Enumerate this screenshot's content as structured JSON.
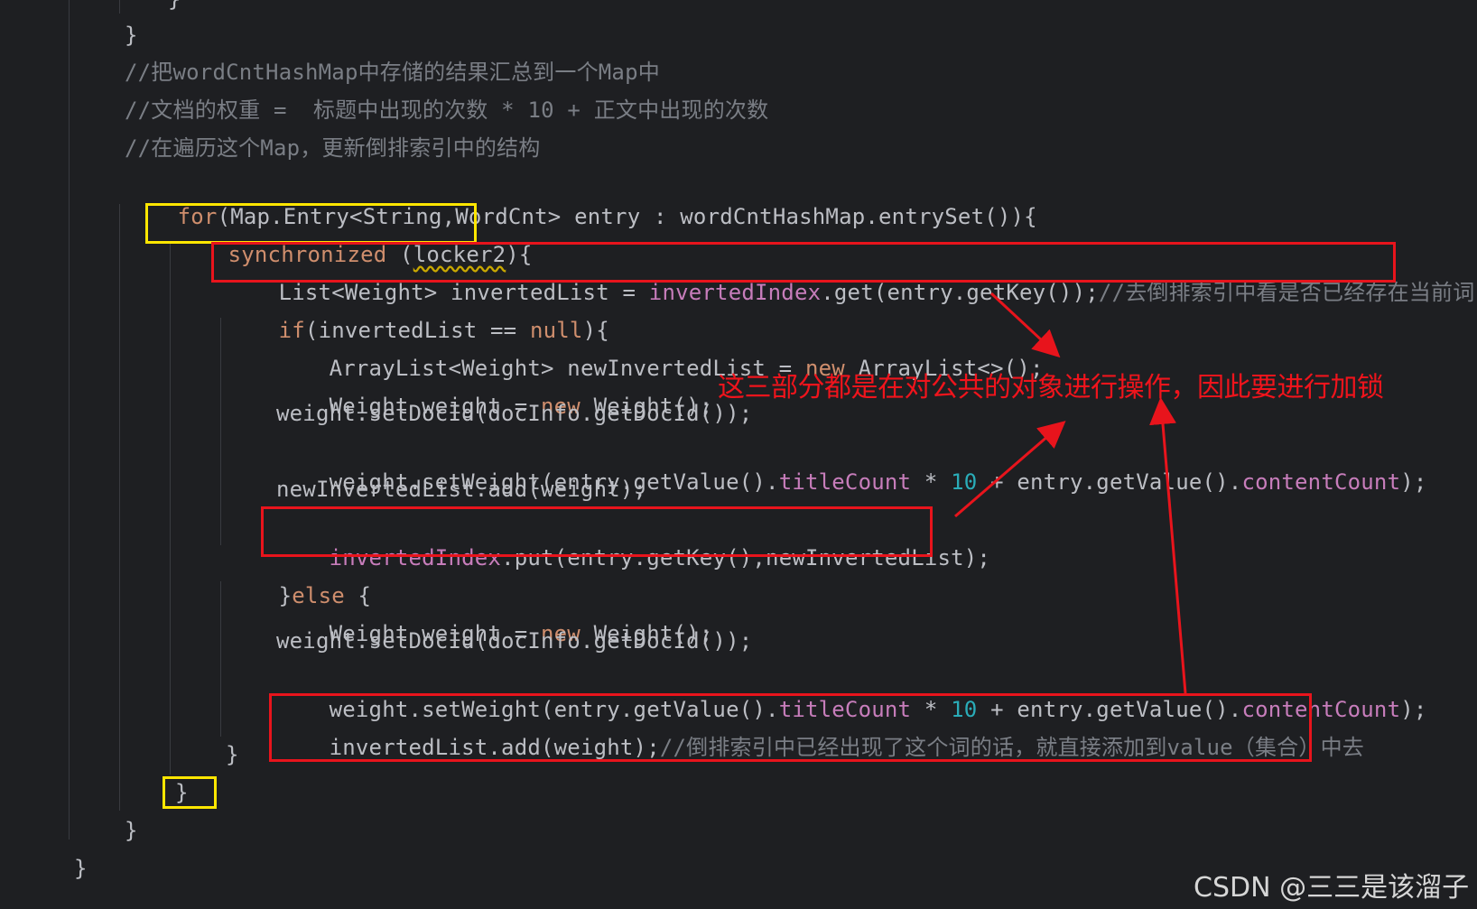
{
  "code": {
    "l0": "}",
    "l1": "}",
    "c1": "//把wordCntHashMap中存储的结果汇总到一个Map中",
    "c2": "//文档的权重 =  标题中出现的次数 * 10 + 正文中出现的次数",
    "c3": "//在遍历这个Map，更新倒排索引中的结构",
    "for_kw": "for",
    "for_rest": "(Map.Entry<String,WordCnt> entry : wordCntHashMap.entrySet()){",
    "sync_kw": "synchronized",
    "sync_open": " (",
    "sync_lock": "locker2",
    "sync_close": "){",
    "list_a": "List<Weight> invertedList = ",
    "list_field": "invertedIndex",
    "list_b": ".get(entry.getKey());",
    "list_comment": "//去倒排索引中看是否已经存在当前词",
    "if_kw": "if",
    "if_a": "(invertedList == ",
    "if_null": "null",
    "if_b": "){",
    "new_list_a": "ArrayList<Weight> newInvertedList = ",
    "new_kw": "new",
    "new_list_b": " ArrayList<>();",
    "weight_decl_a": "Weight weight = ",
    "weight_decl_b": " Weight();",
    "set_doc": "weight.setDocId(docInfo.getDocId());",
    "set_weight_a": "weight.setWeight(entry.getValue().",
    "title_count": "titleCount",
    "set_weight_mul": " * ",
    "ten": "10",
    "set_weight_b": " + entry.getValue().",
    "content_count": "contentCount",
    "set_weight_c": ");",
    "add_new": "newInvertedList.add(weight);",
    "put_field": "invertedIndex",
    "put_rest": ".put(entry.getKey(),newInvertedList);",
    "else_a": "}",
    "else_kw": "else",
    "else_b": " {",
    "add_list": "invertedList.add(weight);",
    "add_list_comment": "//倒排索引中已经出现了这个词的话，就直接添加到value（集合）中去",
    "close_if": "}",
    "close_sync": "}",
    "close_for": "}",
    "close_method": "}"
  },
  "annotation": {
    "text": "这三部分都是在对公共的对象进行操作，因此要进行加锁",
    "color": "#e8141c"
  },
  "watermark": "CSDN @三三是该溜子",
  "colors": {
    "background": "#1e1f22",
    "keyword": "#cf8e6d",
    "field": "#c77dbb",
    "number": "#2aacb8",
    "comment": "#7a7e85",
    "text": "#bcbec4",
    "highlight_red": "#e8141c",
    "highlight_yellow": "#ffe600"
  }
}
